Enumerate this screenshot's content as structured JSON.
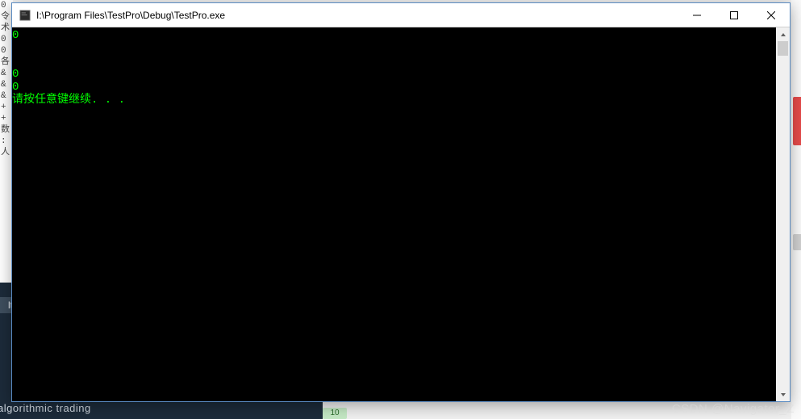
{
  "window": {
    "title": "I:\\Program Files\\TestPro\\Debug\\TestPro.exe"
  },
  "console": {
    "lines": [
      "0",
      "",
      "",
      "0",
      "0",
      "请按任意键继续. . ."
    ]
  },
  "background": {
    "left_chars": [
      "0",
      "令",
      "术",
      "0",
      "0",
      "",
      "各",
      "&",
      "&",
      "&",
      "+",
      "+",
      "数",
      ":",
      "",
      "",
      "人"
    ],
    "tab_label": "lt",
    "bottom_text": "esting in algorithmic trading",
    "green_pill": "10"
  },
  "watermark": "CSDN @Navigator_Z"
}
